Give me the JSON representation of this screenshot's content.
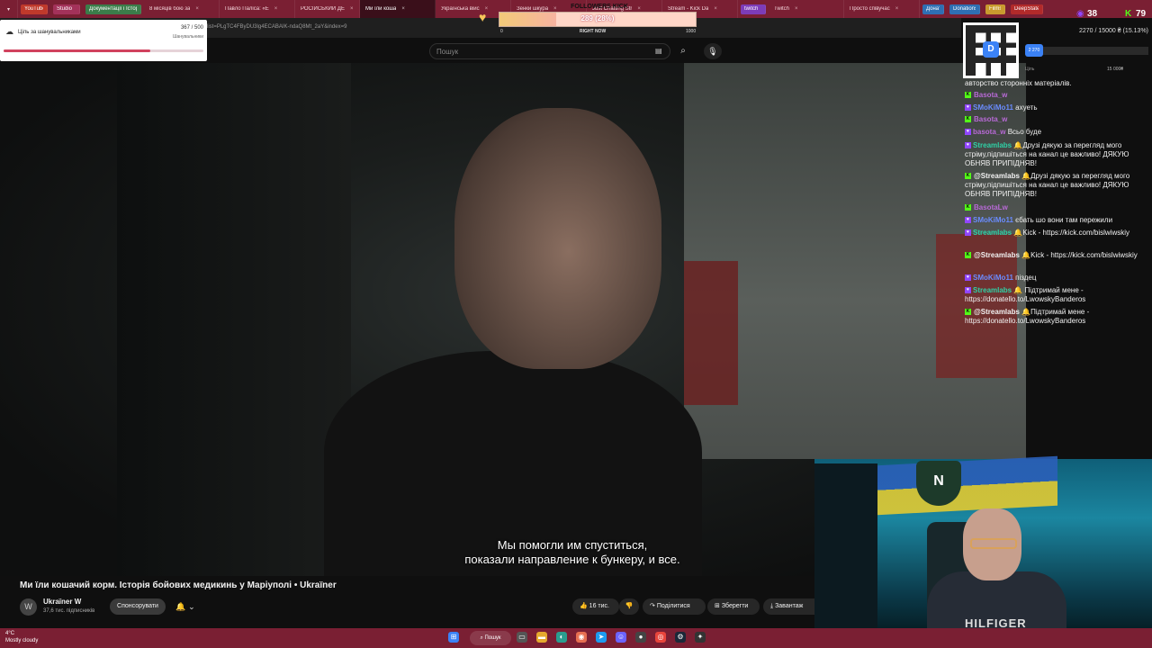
{
  "browser": {
    "tabs": [
      {
        "label": "YouTube",
        "pill": "#c0392b"
      },
      {
        "label": "Studio",
        "pill": "#a3325a"
      },
      {
        "label": "Документації і Історія",
        "pill": "#3b7d4a"
      },
      {
        "label": "8 місяців бою за"
      },
      {
        "label": "Павло Паліса: «Е"
      },
      {
        "label": "РОСІЙСЬКИЙ ДЕ"
      },
      {
        "label": "Ми їли коша",
        "active": true
      },
      {
        "label": "Українська війс"
      },
      {
        "label": "Зенки шкура"
      },
      {
        "label": "Just Chatting Str"
      },
      {
        "label": "Stream - Kick Da"
      },
      {
        "label": "twitch",
        "pill": "#7d3cb8"
      },
      {
        "label": "Twitch"
      },
      {
        "label": "Просто співучас"
      },
      {
        "label": "Донат",
        "pill": "#2f6fb3"
      },
      {
        "label": "Donations",
        "pill": "#2f6fb3"
      },
      {
        "label": "Films",
        "pill": "#c99a2e"
      },
      {
        "label": "DeepState",
        "pill": "#b22a2a"
      }
    ],
    "url_fragment": "list=PLgTC4FByDU3lg4ECABAIK-ndaQ8Mt_2aY&index=9"
  },
  "youtube": {
    "search_placeholder": "Пошук",
    "video_title": "Ми їли кошачий корм. Історія бойових медикинь у Маріуполі • Ukraїner",
    "subtitle_line1": "Мы помогли им спуститься,",
    "subtitle_line2": "показали направление к бункеру, и все.",
    "channel_name": "Ukraїner W",
    "channel_avatar": "W",
    "subscribers": "37,6 тис. підписників",
    "sponsor_label": "Спонсорувати",
    "likes": "16 тис.",
    "share_label": "Поділитися",
    "save_label": "Зберегти",
    "download_label": "Завантаж"
  },
  "goal_widget": {
    "label": "Ціль за шанувальниками",
    "count": "367 / 500",
    "sublabel": "Шанувальники",
    "progress": 0.734
  },
  "followers_widget": {
    "label": "FOLLOWERS KICK",
    "value": "289 (28%)",
    "min": "0",
    "center": "RIGHT NOW",
    "max": "1000",
    "progress": 0.289
  },
  "donation_widget": {
    "text": "2270 / 15000 ₴ (15.13%)",
    "badge": "2 270",
    "left_label": "Ціль",
    "right_label": "15 000₴",
    "qr_letter": "D"
  },
  "stats": {
    "viewers": "38",
    "kick_viewers": "79"
  },
  "chat": [
    {
      "name": "",
      "text": "авторство сторонніх матеріалів.",
      "color": "#f1f1f1",
      "badge": "none"
    },
    {
      "name": "Basota_w",
      "text": "",
      "color": "#b86ad6",
      "badge": "kick"
    },
    {
      "name": "SMoKiMo11",
      "text": "ахуеть",
      "color": "#6a8cff",
      "badge": "twitch"
    },
    {
      "name": "Basota_w",
      "text": "",
      "color": "#b86ad6",
      "badge": "kick"
    },
    {
      "name": "basota_w",
      "text": "Всьо буде",
      "color": "#b86ad6",
      "badge": "twitch"
    },
    {
      "name": "Streamlabs",
      "text": "🔔Друзі дякую за перегляд мого стріму,підпишіться на канал це важливо! ДЯКУЮ ОБНЯВ ПРИПІДНЯВ!",
      "color": "#2fd1a6",
      "badge": "twitch"
    },
    {
      "name": "@Streamlabs",
      "text": "🔔Друзі дякую за перегляд мого стріму,підпишіться на канал це важливо! ДЯКУЮ ОБНЯВ ПРИПІДНЯВ!",
      "color": "#f1f1f1",
      "badge": "kick"
    },
    {
      "name": "BasotaLw",
      "text": "",
      "color": "#b86ad6",
      "badge": "kick"
    },
    {
      "name": "SMoKiMo11",
      "text": "єбать шо вони там пережили",
      "color": "#6a8cff",
      "badge": "twitch"
    },
    {
      "name": "Streamlabs",
      "text": "🔔Kick - https://kick.com/bislwiwskiy",
      "color": "#2fd1a6",
      "badge": "twitch"
    },
    {
      "name": "@Streamlabs",
      "text": "🔔Kick - https://kick.com/bislwiwskiy",
      "color": "#f1f1f1",
      "badge": "kick"
    },
    {
      "name": "SMoKiMo11",
      "text": "піздец",
      "color": "#6a8cff",
      "badge": "twitch"
    },
    {
      "name": "Streamlabs",
      "text": "🔔 Підтримай мене - https://donatello.to/LwowskyBanderos",
      "color": "#2fd1a6",
      "badge": "twitch"
    },
    {
      "name": "@Streamlabs",
      "text": "🔔Підтримай мене - https://donatello.to/LwowskyBanderos",
      "color": "#f1f1f1",
      "badge": "kick"
    }
  ],
  "webcam": {
    "shirt_text": "HILFIGER",
    "emblem": "N"
  },
  "taskbar": {
    "temperature": "4°C",
    "weather": "Mostly cloudy",
    "search_label": "Пошук"
  },
  "colors": {
    "tab_bar": "#7a1f33",
    "kick_green": "#53fc18",
    "accent_pink": "#d1425e"
  }
}
